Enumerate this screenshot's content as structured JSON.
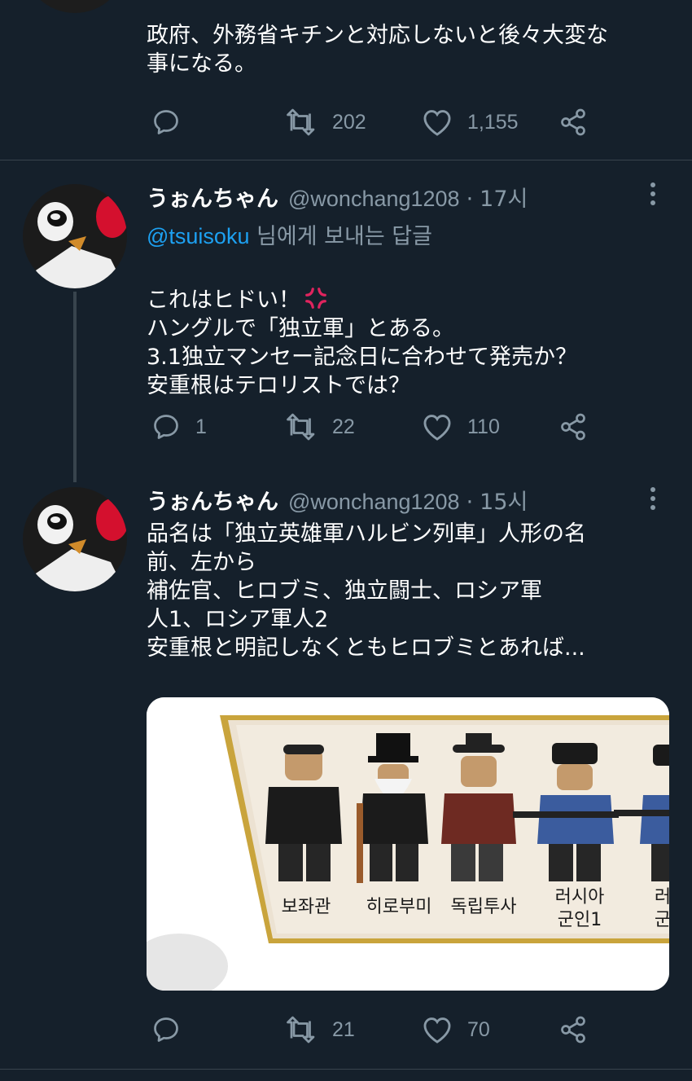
{
  "tweet0": {
    "text": "政府、外務省キチンと対応しないと後々大変な\n事になる。",
    "actions": {
      "reply_count": "",
      "retweet_count": "202",
      "like_count": "1,155"
    }
  },
  "tweet1": {
    "display_name": "うぉんちゃん",
    "handle": "@wonchang1208",
    "separator": "·",
    "time": "17시",
    "reply_mention": "@tsuisoku",
    "reply_suffix": " 님에게 보내는 답글",
    "text_line1": "これはヒドい！",
    "text_rest": "ハングルで「独立軍」とある。\n3.1独立マンセー記念日に合わせて発売か？\n安重根はテロリストでは？",
    "actions": {
      "reply_count": "1",
      "retweet_count": "22",
      "like_count": "110"
    }
  },
  "tweet2": {
    "display_name": "うぉんちゃん",
    "handle": "@wonchang1208",
    "separator": "·",
    "time": "15시",
    "text": "品名は「独立英雄軍ハルビン列車」人形の名\n前、左から\n補佐官、ヒロブミ、独立闘士、ロシア軍\n人1、ロシア軍人2\n安重根と明記しなくともヒロブミとあれば...",
    "media": {
      "labels": [
        "보좌관",
        "히로부미",
        "독립투사",
        "러시아\n군인1",
        "러\n군"
      ]
    },
    "actions": {
      "reply_count": "",
      "retweet_count": "21",
      "like_count": "70"
    }
  },
  "colors": {
    "background": "#15202b",
    "divider": "#38444d",
    "muted": "#8899a6",
    "link": "#1da1f2",
    "anger_emoji": "#e0245e"
  }
}
